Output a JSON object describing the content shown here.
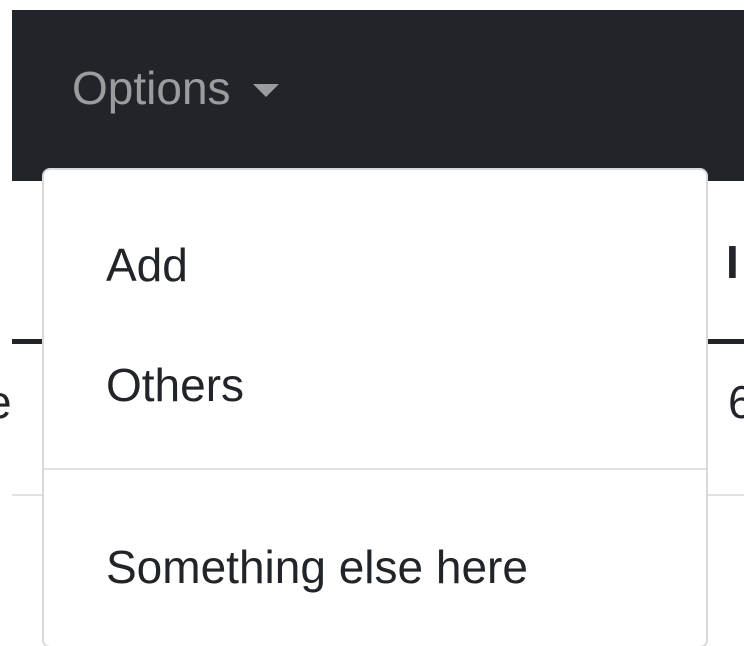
{
  "navbar": {
    "toggle_label": "Options",
    "toggle_icon": "caret-down-icon",
    "background_color": "#212529"
  },
  "background_table": {
    "header_fragment_right": "I",
    "row_fragment_left": "e",
    "row_fragment_right": "6"
  },
  "dropdown": {
    "items": [
      {
        "label": "Add"
      },
      {
        "label": "Others"
      },
      {
        "label": "Something else here"
      }
    ]
  }
}
